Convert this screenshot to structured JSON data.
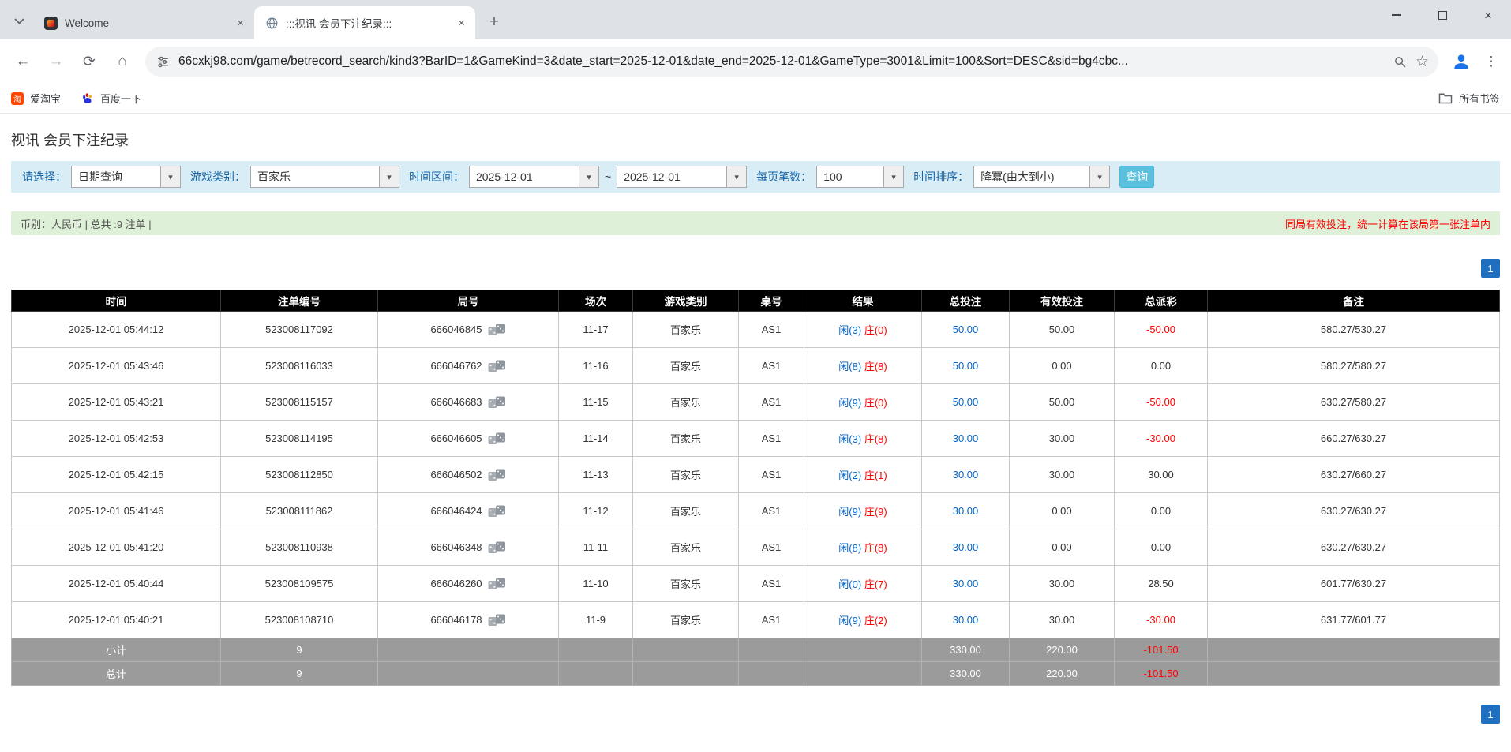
{
  "icons": {
    "back": "←",
    "forward": "→",
    "refresh": "⟳",
    "home": "⌂",
    "close_tab": "×",
    "new_tab": "+",
    "menu": "⋮",
    "star": "☆",
    "window_close": "×",
    "dropdown": "▾"
  },
  "browser": {
    "tabs": [
      {
        "title": "Welcome"
      },
      {
        "title": ":::视讯 会员下注纪录:::"
      }
    ],
    "url": "66cxkj98.com/game/betrecord_search/kind3?BarID=1&GameKind=3&date_start=2025-12-01&date_end=2025-12-01&GameType=3001&Limit=100&Sort=DESC&sid=bg4cbc...",
    "bookmarks": [
      {
        "label": "爱淘宝",
        "icon_text": "淘"
      },
      {
        "label": "百度一下"
      }
    ],
    "all_bookmarks_label": "所有书签"
  },
  "page": {
    "title": "视讯 会员下注纪录",
    "filter": {
      "select_label": "请选择：",
      "select_value": "日期查询",
      "game_label": "游戏类别：",
      "game_value": "百家乐",
      "range_label": "时间区间：",
      "date_start": "2025-12-01",
      "tilde": "~",
      "date_end": "2025-12-01",
      "per_page_label": "每页笔数：",
      "per_page_value": "100",
      "sort_label": "时间排序：",
      "sort_value": "降冪(由大到小)",
      "search_button": "查询"
    },
    "info": {
      "left": "币别：人民币 | 总共 :9 注单 |",
      "right": "同局有效投注，统一计算在该局第一张注单内"
    },
    "pagination": {
      "page": "1"
    }
  },
  "table": {
    "headers": [
      "时间",
      "注单编号",
      "局号",
      "场次",
      "游戏类别",
      "桌号",
      "结果",
      "总投注",
      "有效投注",
      "总派彩",
      "备注"
    ],
    "rows": [
      {
        "time": "2025-12-01 05:44:12",
        "bet_id": "523008117092",
        "round": "666046845",
        "session": "11-17",
        "game": "百家乐",
        "table": "AS1",
        "player": "闲(3)",
        "banker": "庄(0)",
        "total_bet": "50.00",
        "valid_bet": "50.00",
        "payout": "-50.00",
        "payout_red": true,
        "note": "580.27/530.27"
      },
      {
        "time": "2025-12-01 05:43:46",
        "bet_id": "523008116033",
        "round": "666046762",
        "session": "11-16",
        "game": "百家乐",
        "table": "AS1",
        "player": "闲(8)",
        "banker": "庄(8)",
        "total_bet": "50.00",
        "valid_bet": "0.00",
        "payout": "0.00",
        "payout_red": false,
        "note": "580.27/580.27"
      },
      {
        "time": "2025-12-01 05:43:21",
        "bet_id": "523008115157",
        "round": "666046683",
        "session": "11-15",
        "game": "百家乐",
        "table": "AS1",
        "player": "闲(9)",
        "banker": "庄(0)",
        "total_bet": "50.00",
        "valid_bet": "50.00",
        "payout": "-50.00",
        "payout_red": true,
        "note": "630.27/580.27"
      },
      {
        "time": "2025-12-01 05:42:53",
        "bet_id": "523008114195",
        "round": "666046605",
        "session": "11-14",
        "game": "百家乐",
        "table": "AS1",
        "player": "闲(3)",
        "banker": "庄(8)",
        "total_bet": "30.00",
        "valid_bet": "30.00",
        "payout": "-30.00",
        "payout_red": true,
        "note": "660.27/630.27"
      },
      {
        "time": "2025-12-01 05:42:15",
        "bet_id": "523008112850",
        "round": "666046502",
        "session": "11-13",
        "game": "百家乐",
        "table": "AS1",
        "player": "闲(2)",
        "banker": "庄(1)",
        "total_bet": "30.00",
        "valid_bet": "30.00",
        "payout": "30.00",
        "payout_red": false,
        "note": "630.27/660.27"
      },
      {
        "time": "2025-12-01 05:41:46",
        "bet_id": "523008111862",
        "round": "666046424",
        "session": "11-12",
        "game": "百家乐",
        "table": "AS1",
        "player": "闲(9)",
        "banker": "庄(9)",
        "total_bet": "30.00",
        "valid_bet": "0.00",
        "payout": "0.00",
        "payout_red": false,
        "note": "630.27/630.27"
      },
      {
        "time": "2025-12-01 05:41:20",
        "bet_id": "523008110938",
        "round": "666046348",
        "session": "11-11",
        "game": "百家乐",
        "table": "AS1",
        "player": "闲(8)",
        "banker": "庄(8)",
        "total_bet": "30.00",
        "valid_bet": "0.00",
        "payout": "0.00",
        "payout_red": false,
        "note": "630.27/630.27"
      },
      {
        "time": "2025-12-01 05:40:44",
        "bet_id": "523008109575",
        "round": "666046260",
        "session": "11-10",
        "game": "百家乐",
        "table": "AS1",
        "player": "闲(0)",
        "banker": "庄(7)",
        "total_bet": "30.00",
        "valid_bet": "30.00",
        "payout": "28.50",
        "payout_red": false,
        "note": "601.77/630.27"
      },
      {
        "time": "2025-12-01 05:40:21",
        "bet_id": "523008108710",
        "round": "666046178",
        "session": "11-9",
        "game": "百家乐",
        "table": "AS1",
        "player": "闲(9)",
        "banker": "庄(2)",
        "total_bet": "30.00",
        "valid_bet": "30.00",
        "payout": "-30.00",
        "payout_red": true,
        "note": "631.77/601.77"
      }
    ],
    "subtotal": {
      "label": "小计",
      "count": "9",
      "total_bet": "330.00",
      "valid_bet": "220.00",
      "payout": "-101.50"
    },
    "total": {
      "label": "总计",
      "count": "9",
      "total_bet": "330.00",
      "valid_bet": "220.00",
      "payout": "-101.50"
    }
  }
}
